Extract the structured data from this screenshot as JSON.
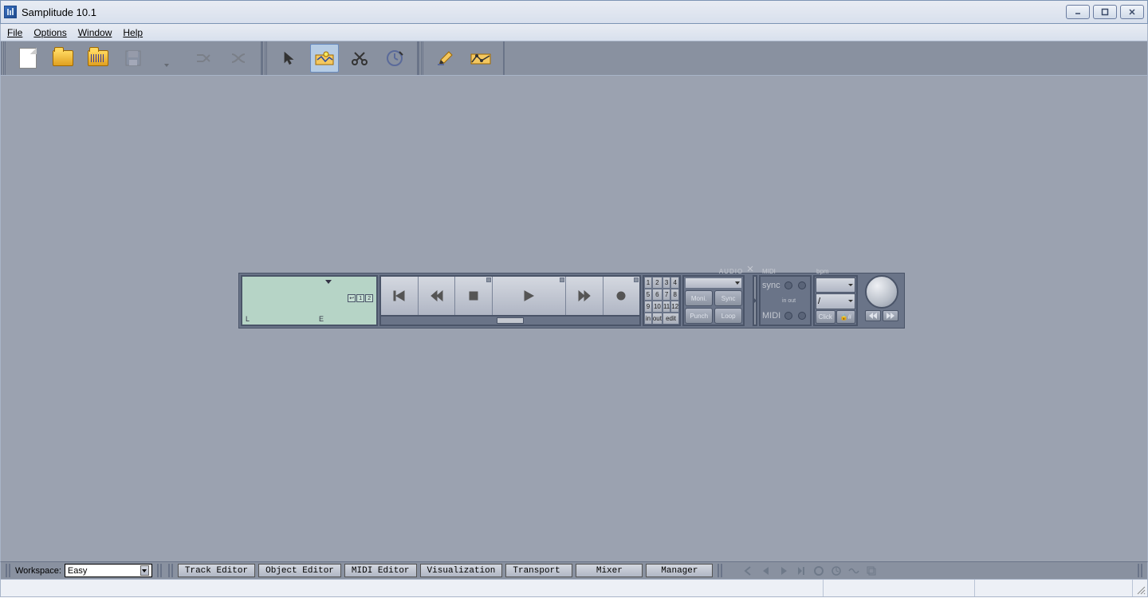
{
  "title": "Samplitude 10.1",
  "menu": {
    "items": [
      "File",
      "Options",
      "Window",
      "Help"
    ]
  },
  "toolbar": {
    "group1": [
      "new-file",
      "open-folder",
      "open-wave",
      "save",
      "save-dropdown",
      "route-toggle",
      "shuffle"
    ],
    "group2": [
      "cursor-tool",
      "pencil-tool",
      "cut-tool",
      "time-tool"
    ],
    "group3": [
      "draw-tool",
      "automation-tool"
    ]
  },
  "transport": {
    "lcd": {
      "L": "L",
      "E": "E",
      "small": [
        "↩",
        "1",
        "2"
      ]
    },
    "play_buttons": [
      "go-start",
      "rewind",
      "stop",
      "play",
      "forward",
      "record"
    ],
    "markers": {
      "row1": [
        "1",
        "2",
        "3",
        "4"
      ],
      "row2": [
        "5",
        "6",
        "7",
        "8"
      ],
      "row3": [
        "9",
        "10",
        "11",
        "12"
      ],
      "row4": [
        "in",
        "out",
        "edit"
      ]
    },
    "audio": {
      "label": "AUDIO",
      "moni": "Moni.",
      "sync": "Sync",
      "punch": "Punch",
      "loop": "Loop"
    },
    "midi": {
      "label": "MIDI",
      "sync": "sync",
      "inout": "in out",
      "midi": "MIDI"
    },
    "bpm": {
      "label": "bpm",
      "sig": "/",
      "click": "Click",
      "lock": "🔒#"
    }
  },
  "workspace": {
    "label": "Workspace:",
    "value": "Easy",
    "tabs": [
      "Track Editor",
      "Object Editor",
      "MIDI Editor",
      "Visualization",
      "Transport",
      "Mixer",
      "Manager"
    ]
  }
}
